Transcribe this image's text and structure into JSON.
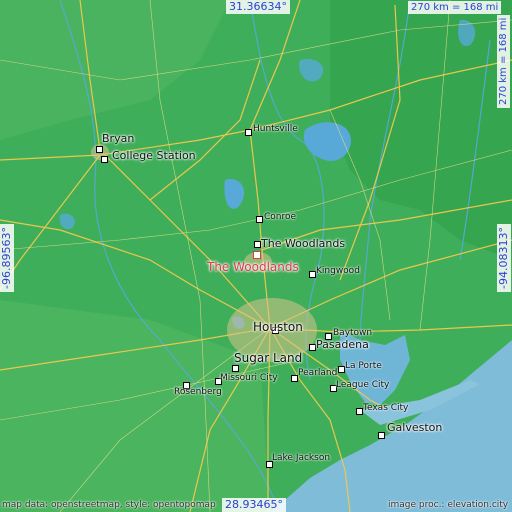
{
  "map": {
    "place": "The Woodlands",
    "coords": {
      "north": "31.36634°",
      "south": "28.93465°",
      "west": "-96.89563°",
      "east": "-94.08313°"
    },
    "scale": "270 km = 168 mi",
    "cities": [
      {
        "id": "bryan",
        "name": "Bryan"
      },
      {
        "id": "college-station",
        "name": "College Station"
      },
      {
        "id": "huntsville",
        "name": "Huntsville"
      },
      {
        "id": "conroe",
        "name": "Conroe"
      },
      {
        "id": "the-woodlands-label",
        "name": "The Woodlands"
      },
      {
        "id": "kingwood",
        "name": "Kingwood"
      },
      {
        "id": "houston",
        "name": "Houston"
      },
      {
        "id": "baytown",
        "name": "Baytown"
      },
      {
        "id": "pasadena",
        "name": "Pasadena"
      },
      {
        "id": "sugar-land",
        "name": "Sugar Land"
      },
      {
        "id": "la-porte",
        "name": "La Porte"
      },
      {
        "id": "missouri-city",
        "name": "Missouri City"
      },
      {
        "id": "rosenberg",
        "name": "Rosenberg"
      },
      {
        "id": "pearland",
        "name": "Pearland"
      },
      {
        "id": "league-city",
        "name": "League City"
      },
      {
        "id": "texas-city",
        "name": "Texas City"
      },
      {
        "id": "galveston",
        "name": "Galveston"
      },
      {
        "id": "lake-jackson",
        "name": "Lake Jackson"
      }
    ],
    "credits": {
      "left": "map data: openstreetmap, style: opentopomap",
      "right": "image proc.: elevation.city"
    },
    "colors": {
      "land": "#3fae5a",
      "sea": "#7fbcd8",
      "water": "#58a9d8",
      "roads": "#f2c94c",
      "focus": "#e23a4d",
      "coord_text": "#2d3fd0"
    }
  }
}
